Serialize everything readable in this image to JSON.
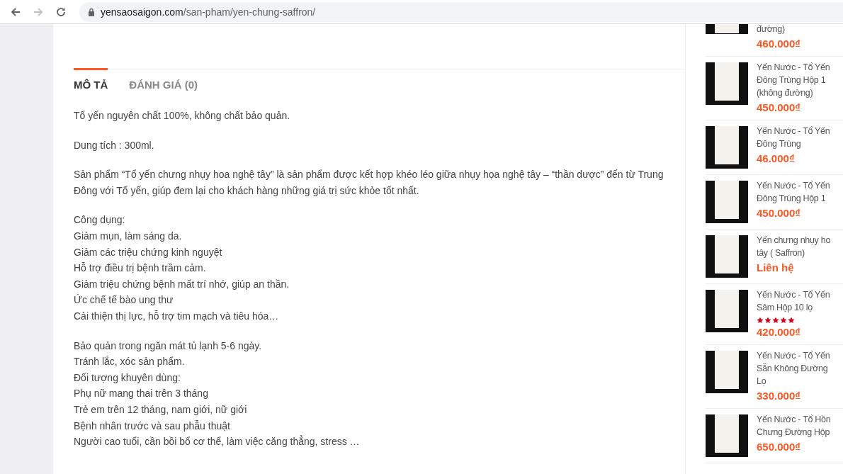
{
  "browser": {
    "url_domain": "yensaosaigon.com",
    "url_path": "/san-pham/yen-chung-saffron/"
  },
  "tabs": [
    {
      "label": "MÔ TẢ",
      "selected": true
    },
    {
      "label": "ĐÁNH GIÁ (0)",
      "selected": false
    }
  ],
  "description": [
    [
      "Tổ yến nguyên chất 100%, không chất bảo quản."
    ],
    [
      "Dung tích : 300ml."
    ],
    [
      "Sản phẩm “Tổ yến chưng nhụy hoa nghệ tây” là sản phẩm được kết hợp khéo léo giữa nhụy họa nghệ tây – “thần dược” đến từ Trung Đông với Tổ yến, giúp đem lại cho khách hàng những giá trị sức khỏe tốt nhất."
    ],
    [
      "Công dụng:",
      "Giảm mụn, làm sáng da.",
      "Giảm các triệu chứng kinh nguyệt",
      "Hỗ trợ điều trị bệnh trầm cảm.",
      "Giảm triệu chứng bệnh mất trí nhớ, giúp an thần.",
      "Ức chế tế bào ung thư",
      "Cải thiện thị lực, hỗ trợ tim mạch và tiêu hóa…"
    ],
    [
      "Bảo quản trong ngăn mát tủ lạnh 5-6 ngày.",
      "Tránh lắc, xóc sản phẩm.",
      "Đối tượng khuyên dùng:",
      "Phụ nữ mang thai trên 3 tháng",
      "Trẻ em trên 12 tháng, nam giới, nữ giới",
      "Bệnh nhân trước và sau phẫu thuật",
      "Người cao tuổi, cần bồi bổ cơ thể, làm việc căng thẳng, stress …"
    ]
  ],
  "products": [
    {
      "title": [
        "đường)"
      ],
      "price": "460.000₫",
      "partial": true
    },
    {
      "title": [
        "Yến Nước - Tổ Yến",
        "Đông Trùng Hộp 1",
        "(không đường)"
      ],
      "price": "450.000₫",
      "partial": false
    },
    {
      "title": [
        "Yến Nước - Tổ Yến",
        "Đông Trùng"
      ],
      "price": "46.000₫",
      "partial": false
    },
    {
      "title": [
        "Yến Nước - Tổ Yến",
        "Đông Trùng Hộp 1"
      ],
      "price": "450.000₫",
      "partial": false
    },
    {
      "title": [
        "Yến chưng nhụy ho",
        "tây ( Saffron)"
      ],
      "price": "Liên hệ",
      "partial": false
    },
    {
      "title": [
        "Yến Nước - Tổ Yến",
        "Sâm Hộp 10 lọ"
      ],
      "stars": 5,
      "price": "420.000₫",
      "partial": false
    },
    {
      "title": [
        "Yến Nước - Tổ Yến",
        "Sẵn Không Đường",
        "Lọ"
      ],
      "price": "330.000₫",
      "partial": false
    },
    {
      "title": [
        "Yến Nước - Tổ Hồn",
        "Chưng Đường Hộp"
      ],
      "price": "650.000₫",
      "partial": false
    }
  ]
}
